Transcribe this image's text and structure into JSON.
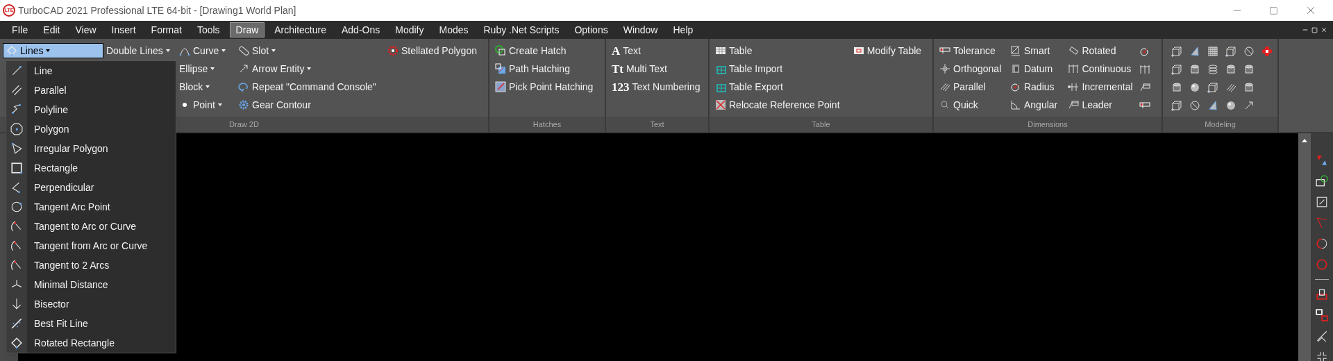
{
  "window": {
    "logo": "LTE",
    "title": "TurboCAD 2021 Professional LTE 64-bit - [Drawing1 World Plan]"
  },
  "menu_bar": [
    {
      "label": "FIle",
      "selected": false
    },
    {
      "label": "Edit",
      "selected": false
    },
    {
      "label": "View",
      "selected": false
    },
    {
      "label": "Insert",
      "selected": false
    },
    {
      "label": "Format",
      "selected": false
    },
    {
      "label": "Tools",
      "selected": false
    },
    {
      "label": "Draw",
      "selected": true
    },
    {
      "label": "Architecture",
      "selected": false
    },
    {
      "label": "Add-Ons",
      "selected": false
    },
    {
      "label": "Modify",
      "selected": false
    },
    {
      "label": "Modes",
      "selected": false
    },
    {
      "label": "Ruby .Net Scripts",
      "selected": false
    },
    {
      "label": "Options",
      "selected": false
    },
    {
      "label": "Window",
      "selected": false
    },
    {
      "label": "Help",
      "selected": false
    }
  ],
  "ribbon": [
    {
      "label": "Draw 2D",
      "columns": [
        [
          {
            "label": "Lines",
            "dropdown": true,
            "open": true
          }
        ],
        [
          {
            "label": "Double Lines",
            "dropdown": true,
            "open": false
          }
        ],
        [
          {
            "label": "Curve",
            "dropdown": true,
            "open": false
          },
          {
            "label": "Ellipse",
            "dropdown": true,
            "open": false
          },
          {
            "label": "Block",
            "dropdown": true,
            "open": false
          },
          {
            "label": "Point",
            "dropdown": true,
            "open": false
          }
        ],
        [
          {
            "label": "Slot",
            "dropdown": true,
            "open": false
          },
          {
            "label": "Arrow Entity",
            "dropdown": true,
            "open": false
          },
          {
            "label": "Repeat \"Command Console\"",
            "dropdown": false,
            "open": false
          },
          {
            "label": "Gear Contour",
            "dropdown": false,
            "open": false
          }
        ],
        [
          {
            "label": "Stellated Polygon",
            "dropdown": false,
            "open": false
          }
        ]
      ]
    },
    {
      "label": "Hatches",
      "columns": [
        [
          {
            "label": "Create Hatch"
          },
          {
            "label": "Path Hatching"
          },
          {
            "label": "Pick Point Hatching"
          }
        ]
      ]
    },
    {
      "label": "Text",
      "columns": [
        [
          {
            "label": "Text",
            "glyph": "A"
          },
          {
            "label": "Multi Text",
            "glyph": "Tt"
          },
          {
            "label": "Text Numbering",
            "glyph": "123"
          }
        ]
      ]
    },
    {
      "label": "Table",
      "columns": [
        [
          {
            "label": "Table"
          },
          {
            "label": "Table Import"
          },
          {
            "label": "Table Export"
          },
          {
            "label": "Relocate Reference Point"
          }
        ],
        [
          {
            "label": "Modify Table"
          }
        ]
      ]
    },
    {
      "label": "Dimensions",
      "columns": [
        [
          {
            "label": "Tolerance"
          },
          {
            "label": "Orthogonal"
          },
          {
            "label": "Parallel"
          },
          {
            "label": "Quick"
          }
        ],
        [
          {
            "label": "Smart"
          },
          {
            "label": "Datum"
          },
          {
            "label": "Radius"
          },
          {
            "label": "Angular"
          }
        ],
        [
          {
            "label": "Rotated"
          },
          {
            "label": "Continuous"
          },
          {
            "label": "Incremental"
          },
          {
            "label": "Leader"
          }
        ]
      ]
    },
    {
      "label": "Modeling"
    }
  ],
  "lines_menu": [
    "Line",
    "Parallel",
    "Polyline",
    "Polygon",
    "Irregular Polygon",
    "Rectangle",
    "Perpendicular",
    "Tangent Arc Point",
    "Tangent to Arc or Curve",
    "Tangent from Arc or Curve",
    "Tangent to 2 Arcs",
    "Minimal Distance",
    "Bisector",
    "Best Fit Line",
    "Rotated Rectangle"
  ]
}
